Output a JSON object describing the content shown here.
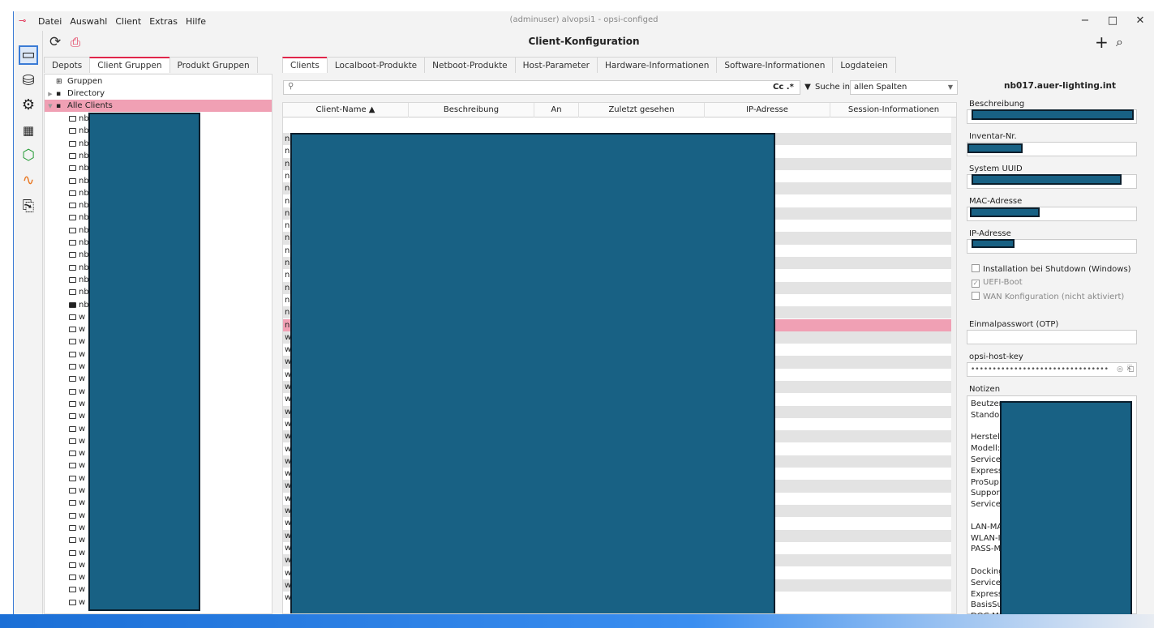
{
  "window": {
    "title": "(adminuser) alvopsi1 - opsi-configed",
    "menu": [
      "Datei",
      "Auswahl",
      "Client",
      "Extras",
      "Hilfe"
    ],
    "controls": [
      "−",
      "□",
      "✕"
    ]
  },
  "toolbar": {
    "page_title": "Client-Konfiguration",
    "reload_icon": "reload-icon",
    "save_icon": "save-icon",
    "plus": "+",
    "search": "⌕"
  },
  "sidebar": {
    "icons": [
      "client-config-icon",
      "depot-icon",
      "server-config-icon",
      "table-view-icon",
      "product-icon",
      "health-check-icon",
      "log-icon"
    ]
  },
  "left_tabs": [
    "Depots",
    "Client Gruppen",
    "Produkt Gruppen"
  ],
  "main_tabs": [
    "Clients",
    "Localboot-Produkte",
    "Netboot-Produkte",
    "Host-Parameter",
    "Hardware-Informationen",
    "Software-Informationen",
    "Logdateien"
  ],
  "tree": {
    "groups_label": "Gruppen",
    "directory_label": "Directory",
    "all_clients_label": "Alle Clients",
    "client_prefixes": [
      "nb",
      "nb",
      "nb",
      "nb",
      "nb",
      "nb",
      "nb",
      "nb",
      "nb",
      "nb",
      "nb",
      "nb",
      "nb",
      "nb",
      "nb",
      "nb",
      "w",
      "w",
      "w",
      "w",
      "w",
      "w",
      "w",
      "w",
      "w",
      "w",
      "w",
      "w",
      "w",
      "w",
      "w",
      "w",
      "w",
      "w",
      "w",
      "w",
      "w",
      "w",
      "w",
      "w"
    ]
  },
  "search": {
    "cc_label": "Cc",
    "regex_label": ".*",
    "search_in_label": "Suche in",
    "search_in_value": "allen Spalten"
  },
  "table": {
    "columns": [
      "Client-Name ▲",
      "Beschreibung",
      "An",
      "Zuletzt gesehen",
      "IP-Adresse",
      "Session-Informationen"
    ],
    "first_col_prefixes": [
      "n",
      "n",
      "n",
      "n",
      "n",
      "n",
      "n",
      "n",
      "n",
      "n",
      "n",
      "n",
      "n",
      "n",
      "n",
      "n",
      "w",
      "w",
      "w",
      "w",
      "w",
      "w",
      "w",
      "w",
      "w",
      "w",
      "w",
      "w",
      "w",
      "w",
      "w",
      "w",
      "w",
      "w",
      "w",
      "w",
      "w",
      "w"
    ],
    "selected_index": 15
  },
  "details": {
    "host_name": "nb017.auer-lighting.int",
    "description_label": "Beschreibung",
    "inventory_label": "Inventar-Nr.",
    "uuid_label": "System UUID",
    "mac_label": "MAC-Adresse",
    "ip_label": "IP-Adresse",
    "check_shutdown": "Installation bei Shutdown (Windows)",
    "check_uefi": "UEFI-Boot",
    "check_wan": "WAN Konfiguration (nicht aktiviert)",
    "otp_label": "Einmalpasswort (OTP)",
    "hostkey_label": "opsi-host-key",
    "hostkey_value": "••••••••••••••••••••••••••••••••",
    "notes_label": "Notizen",
    "notes_lines": [
      "Beutzer",
      "Standor",
      "",
      "Herstell",
      "Modell:",
      "Service-",
      "Express",
      "ProSup",
      "Suppor",
      "Servicel",
      "",
      "LAN-MA",
      "WLAN-I",
      "PASS-M",
      "",
      "Docking",
      "Service-",
      "Express",
      "BasisSu",
      "DOC-MA"
    ]
  },
  "colors": {
    "accent": "#e0264b",
    "selection": "#f0a0b4",
    "redaction": "#186184"
  }
}
